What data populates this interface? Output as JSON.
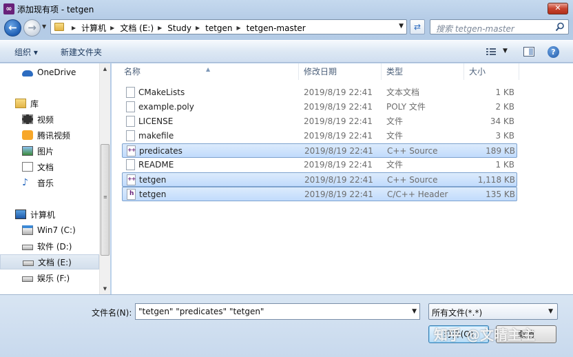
{
  "window": {
    "title": "添加现有项 - tetgen",
    "close_label": "✕"
  },
  "address": {
    "breadcrumbs": [
      "计算机",
      "文档 (E:)",
      "Study",
      "tetgen",
      "tetgen-master"
    ]
  },
  "search": {
    "placeholder": "搜索 tetgen-master"
  },
  "toolbar": {
    "organize": "组织 ▾",
    "new_folder": "新建文件夹"
  },
  "nav": {
    "items": [
      {
        "label": "OneDrive",
        "icon": "cloud-icon"
      },
      {
        "label": "库",
        "icon": "library-icon"
      },
      {
        "label": "视频",
        "icon": "video-icon"
      },
      {
        "label": "腾讯视频",
        "icon": "tencent-video-icon"
      },
      {
        "label": "图片",
        "icon": "picture-icon"
      },
      {
        "label": "文档",
        "icon": "document-icon"
      },
      {
        "label": "音乐",
        "icon": "music-icon"
      },
      {
        "label": "计算机",
        "icon": "computer-icon"
      },
      {
        "label": "Win7 (C:)",
        "icon": "windows-drive-icon"
      },
      {
        "label": "软件 (D:)",
        "icon": "drive-icon"
      },
      {
        "label": "文档 (E:)",
        "icon": "drive-icon"
      },
      {
        "label": "娱乐 (F:)",
        "icon": "drive-icon"
      }
    ]
  },
  "columns": {
    "name": "名称",
    "date": "修改日期",
    "type": "类型",
    "size": "大小"
  },
  "files": [
    {
      "name": "CMakeLists",
      "date": "2019/8/19 22:41",
      "type": "文本文档",
      "size": "1 KB",
      "icon": "file-icon",
      "selected": false
    },
    {
      "name": "example.poly",
      "date": "2019/8/19 22:41",
      "type": "POLY 文件",
      "size": "2 KB",
      "icon": "file-icon",
      "selected": false
    },
    {
      "name": "LICENSE",
      "date": "2019/8/19 22:41",
      "type": "文件",
      "size": "34 KB",
      "icon": "file-icon",
      "selected": false
    },
    {
      "name": "makefile",
      "date": "2019/8/19 22:41",
      "type": "文件",
      "size": "3 KB",
      "icon": "file-icon",
      "selected": false
    },
    {
      "name": "predicates",
      "date": "2019/8/19 22:41",
      "type": "C++ Source",
      "size": "189 KB",
      "icon": "cpp-source-icon",
      "selected": true
    },
    {
      "name": "README",
      "date": "2019/8/19 22:41",
      "type": "文件",
      "size": "1 KB",
      "icon": "file-icon",
      "selected": false
    },
    {
      "name": "tetgen",
      "date": "2019/8/19 22:41",
      "type": "C++ Source",
      "size": "1,118 KB",
      "icon": "cpp-source-icon",
      "selected": true
    },
    {
      "name": "tetgen",
      "date": "2019/8/19 22:41",
      "type": "C/C++ Header",
      "size": "135 KB",
      "icon": "cpp-header-icon",
      "selected": true
    }
  ],
  "filename": {
    "label": "文件名(N):",
    "value": "\"tetgen\" \"predicates\" \"tetgen\""
  },
  "filetype": {
    "value": "所有文件(*.*)"
  },
  "buttons": {
    "open": "打开(O)",
    "cancel": "取消"
  },
  "watermark": "知乎 @文晴主主"
}
